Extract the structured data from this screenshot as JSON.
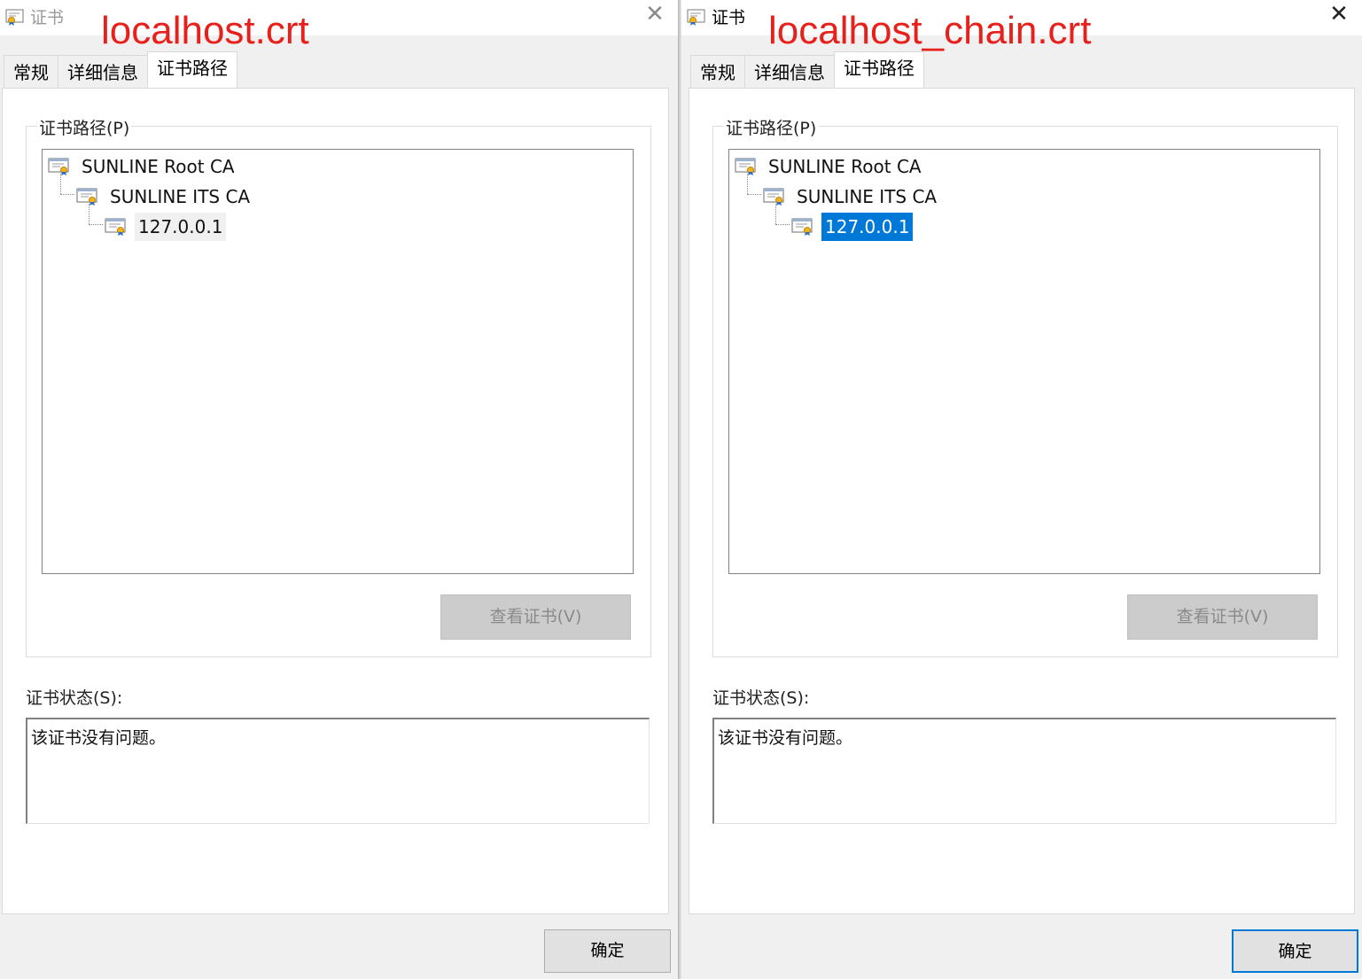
{
  "left": {
    "window_title": "证书",
    "annotation": "localhost.crt",
    "tabs": [
      "常规",
      "详细信息",
      "证书路径"
    ],
    "active_tab": "证书路径",
    "group_label": "证书路径(P)",
    "tree": [
      "SUNLINE Root CA",
      "SUNLINE ITS CA",
      "127.0.0.1"
    ],
    "selected_item": "127.0.0.1",
    "view_button": "查看证书(V)",
    "status_label": "证书状态(S):",
    "status_text": "该证书没有问题。",
    "ok_button": "确定"
  },
  "right": {
    "window_title": "证书",
    "annotation": "localhost_chain.crt",
    "tabs": [
      "常规",
      "详细信息",
      "证书路径"
    ],
    "active_tab": "证书路径",
    "group_label": "证书路径(P)",
    "tree": [
      "SUNLINE Root CA",
      "SUNLINE ITS CA",
      "127.0.0.1"
    ],
    "selected_item": "127.0.0.1",
    "view_button": "查看证书(V)",
    "status_label": "证书状态(S):",
    "status_text": "该证书没有问题。",
    "ok_button": "确定"
  },
  "close_glyph": "✕",
  "colors": {
    "selection": "#0078d7",
    "annotation": "#e8201b",
    "disabled_button": "#cccccc"
  }
}
